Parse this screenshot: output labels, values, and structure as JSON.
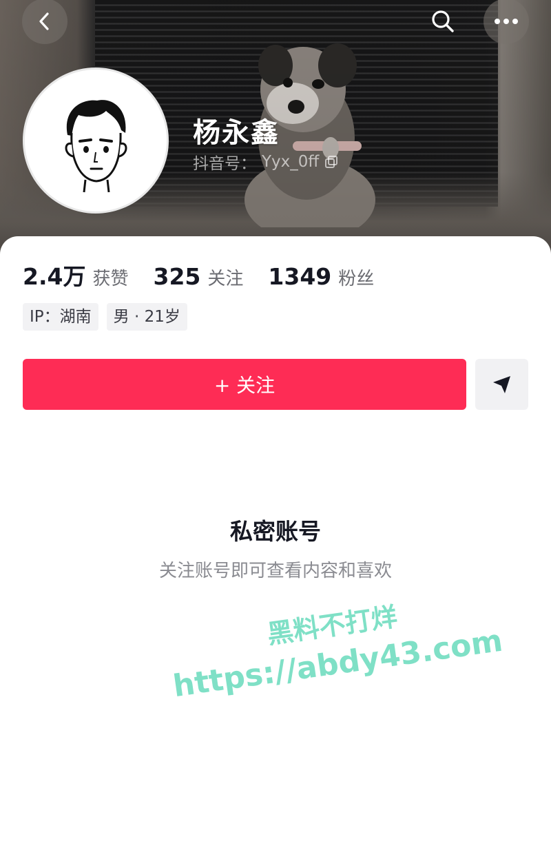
{
  "profile": {
    "name": "杨永鑫",
    "handle_label": "抖音号：",
    "handle": "Yyx_0ff"
  },
  "stats": [
    {
      "value": "2.4万",
      "label": "获赞"
    },
    {
      "value": "325",
      "label": "关注"
    },
    {
      "value": "1349",
      "label": "粉丝"
    }
  ],
  "tags": [
    "IP：湖南",
    "男 · 21岁"
  ],
  "actions": {
    "follow_label": "+ 关注"
  },
  "private": {
    "title": "私密账号",
    "subtitle": "关注账号即可查看内容和喜欢"
  },
  "watermark": {
    "line1": "黑料不打烊",
    "line2": "https://abdy43.com"
  },
  "icons": {
    "back": "chevron-left-icon",
    "search": "search-icon",
    "more": "more-dots-icon",
    "send": "send-icon",
    "copy": "copy-icon"
  },
  "colors": {
    "accent": "#fe2c55",
    "watermark": "#7fe0c6"
  }
}
